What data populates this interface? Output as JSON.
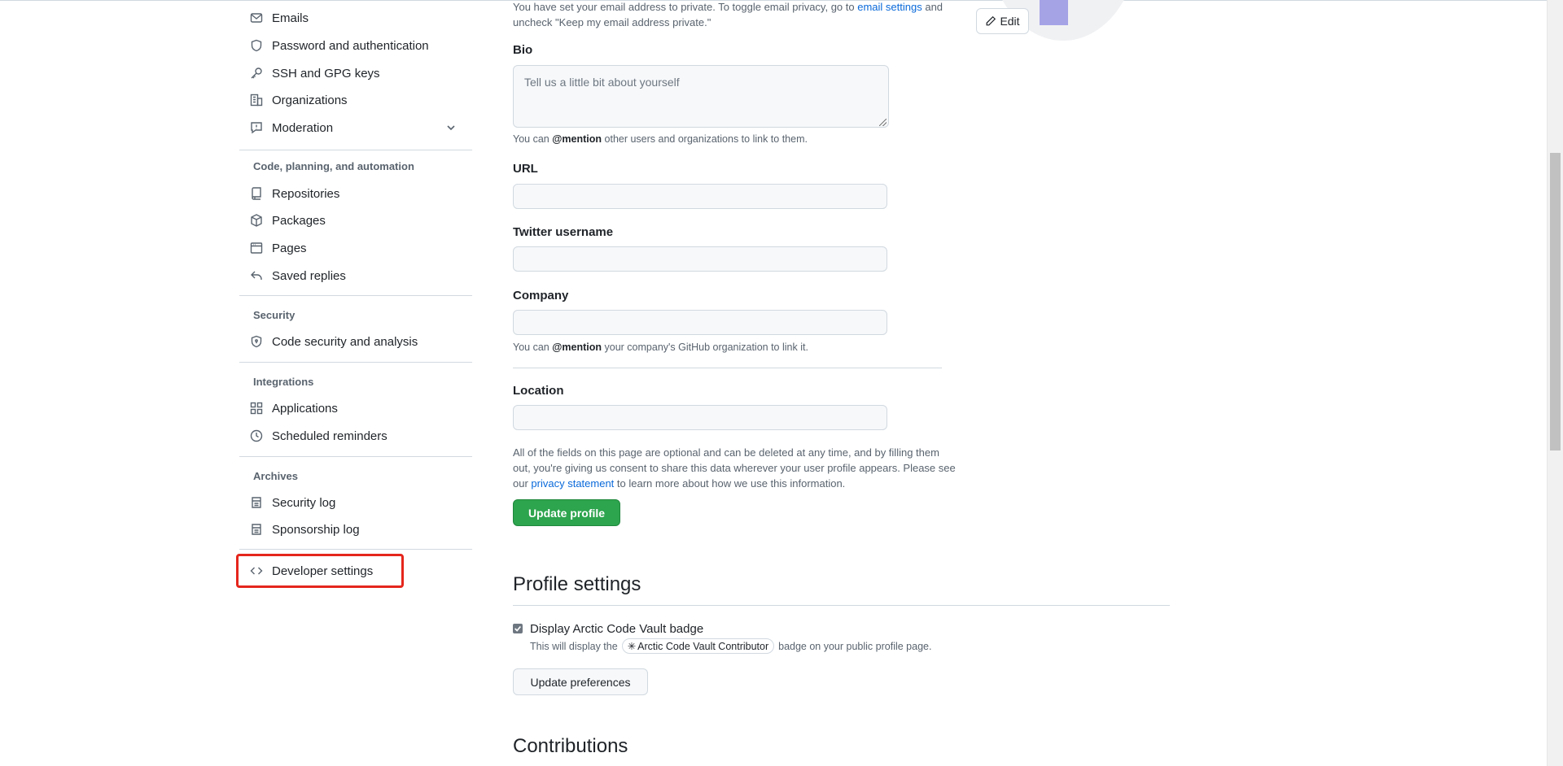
{
  "top_note": {
    "line1_prefix": "You have set your email address to private. To toggle email privacy, go to",
    "line1_link": "email settings",
    "line1_suffix": "and",
    "line2": "uncheck \"Keep my email address private.\""
  },
  "avatar": {
    "edit_label": "Edit"
  },
  "sidebar": {
    "top_items": [
      {
        "label": "Emails",
        "icon": "mail-icon"
      },
      {
        "label": "Password and authentication",
        "icon": "shield-icon"
      },
      {
        "label": "SSH and GPG keys",
        "icon": "key-icon"
      },
      {
        "label": "Organizations",
        "icon": "organization-icon"
      },
      {
        "label": "Moderation",
        "icon": "report-icon"
      }
    ],
    "groups": [
      {
        "title": "Code, planning, and automation",
        "items": [
          {
            "label": "Repositories",
            "icon": "repo-icon"
          },
          {
            "label": "Packages",
            "icon": "package-icon"
          },
          {
            "label": "Pages",
            "icon": "browser-icon"
          },
          {
            "label": "Saved replies",
            "icon": "reply-icon"
          }
        ]
      },
      {
        "title": "Security",
        "items": [
          {
            "label": "Code security and analysis",
            "icon": "shield-lock-icon"
          }
        ]
      },
      {
        "title": "Integrations",
        "items": [
          {
            "label": "Applications",
            "icon": "apps-icon"
          },
          {
            "label": "Scheduled reminders",
            "icon": "clock-icon"
          }
        ]
      },
      {
        "title": "Archives",
        "items": [
          {
            "label": "Security log",
            "icon": "log-icon"
          },
          {
            "label": "Sponsorship log",
            "icon": "log-icon"
          }
        ]
      }
    ],
    "developer_settings": {
      "label": "Developer settings",
      "icon": "code-icon"
    },
    "highlight_color": "#e5261c"
  },
  "form": {
    "bio": {
      "label": "Bio",
      "placeholder": "Tell us a little bit about yourself",
      "value": ""
    },
    "bio_note": {
      "prefix": "You can",
      "mention": "@mention",
      "suffix": "other users and organizations to link to them."
    },
    "url": {
      "label": "URL",
      "value": ""
    },
    "twitter": {
      "label": "Twitter username",
      "value": ""
    },
    "company": {
      "label": "Company",
      "value": ""
    },
    "company_note": {
      "prefix": "You can",
      "mention": "@mention",
      "suffix": "your company's GitHub organization to link it."
    },
    "location": {
      "label": "Location",
      "value": ""
    },
    "disclaimer": {
      "line1": "All of the fields on this page are optional and can be deleted at any time, and by filling them",
      "line2": "out, you're giving us consent to share this data wherever your user profile appears. Please see",
      "line3_prefix": "our",
      "line3_link": "privacy statement",
      "line3_suffix": "to learn more about how we use this information."
    },
    "update_button": "Update profile"
  },
  "profile_settings": {
    "title": "Profile settings",
    "checkbox_label": "Display Arctic Code Vault badge",
    "checked": true,
    "desc_prefix": "This will display the",
    "badge_label": "Arctic Code Vault Contributor",
    "desc_suffix": "badge on your public profile page.",
    "button": "Update preferences"
  },
  "contributions": {
    "title": "Contributions"
  },
  "colors": {
    "primary_green": "#2da44e",
    "link_blue": "#0969da",
    "avatar_purple": "#a5a3e6"
  }
}
